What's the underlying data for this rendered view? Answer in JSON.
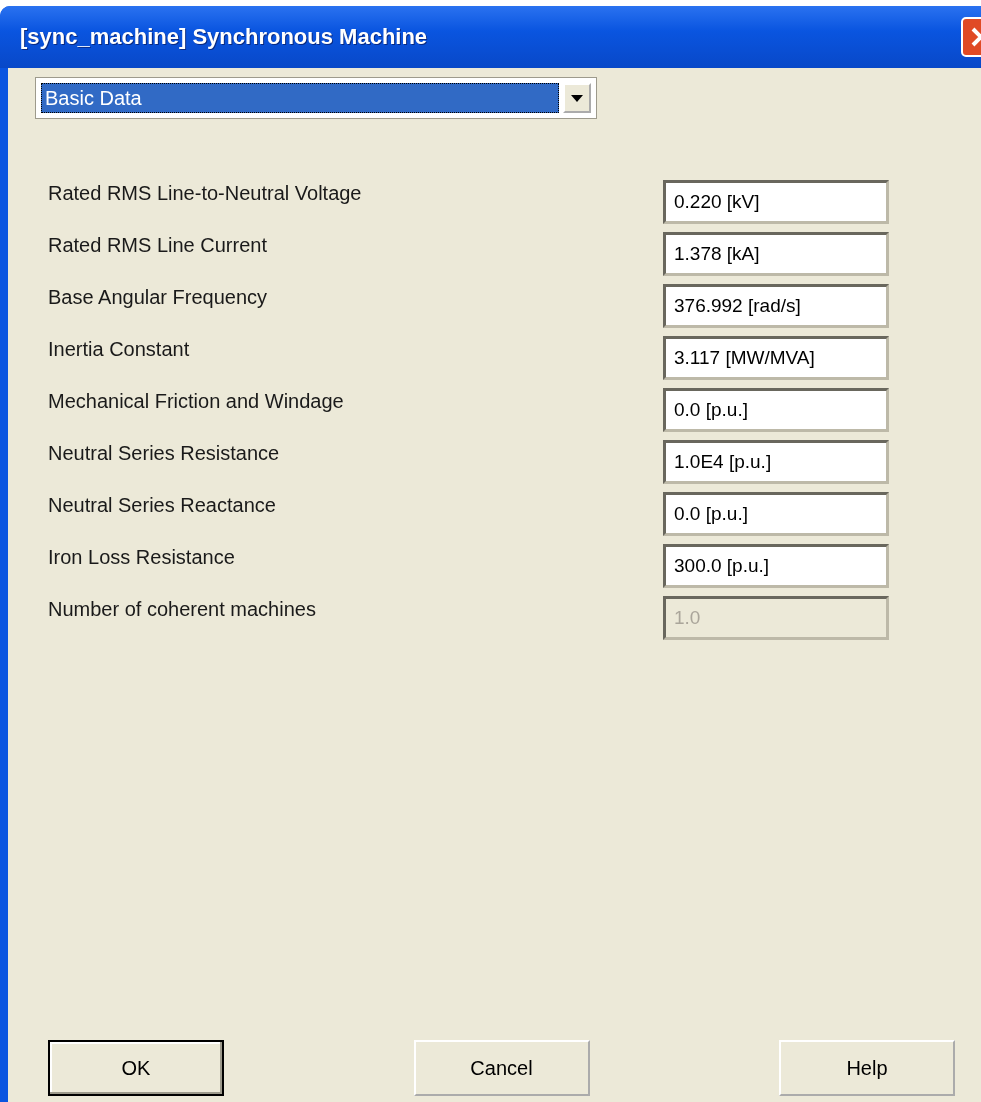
{
  "window": {
    "title": "[sync_machine] Synchronous Machine"
  },
  "page_selector": {
    "value": "Basic Data"
  },
  "fields": [
    {
      "label": "Rated RMS Line-to-Neutral Voltage",
      "value": "0.220 [kV]",
      "disabled": false
    },
    {
      "label": "Rated RMS Line Current",
      "value": "1.378 [kA]",
      "disabled": false
    },
    {
      "label": "Base Angular Frequency",
      "value": "376.992 [rad/s]",
      "disabled": false
    },
    {
      "label": "Inertia Constant",
      "value": "3.117 [MW/MVA]",
      "disabled": false
    },
    {
      "label": "Mechanical Friction and Windage",
      "value": "0.0 [p.u.]",
      "disabled": false
    },
    {
      "label": "Neutral Series Resistance",
      "value": "1.0E4 [p.u.]",
      "disabled": false
    },
    {
      "label": "Neutral Series Reactance",
      "value": "0.0 [p.u.]",
      "disabled": false
    },
    {
      "label": "Iron Loss Resistance",
      "value": "300.0 [p.u.]",
      "disabled": false
    },
    {
      "label": "Number of coherent machines",
      "value": "1.0",
      "disabled": true
    }
  ],
  "buttons": [
    {
      "label": "OK",
      "default": true
    },
    {
      "label": "Cancel",
      "default": false
    },
    {
      "label": "Help",
      "default": false
    }
  ]
}
